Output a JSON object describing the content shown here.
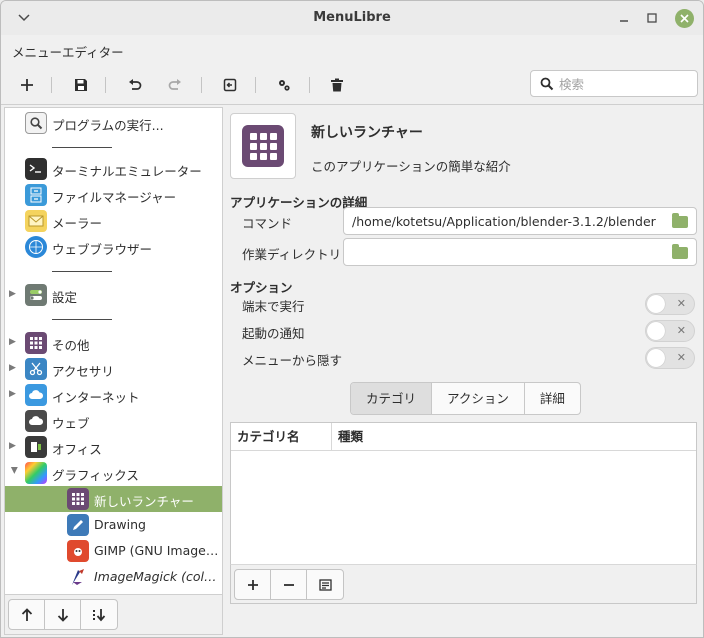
{
  "window": {
    "title": "MenuLibre"
  },
  "menubar": {
    "label": "メニューエディター"
  },
  "search": {
    "placeholder": "検索"
  },
  "tree": {
    "items": [
      {
        "label": "プログラムの実行..."
      },
      {
        "label": "ターミナルエミュレーター"
      },
      {
        "label": "ファイルマネージャー"
      },
      {
        "label": "メーラー"
      },
      {
        "label": "ウェブブラウザー"
      },
      {
        "label": "設定"
      },
      {
        "label": "その他"
      },
      {
        "label": "アクセサリ"
      },
      {
        "label": "インターネット"
      },
      {
        "label": "ウェブ"
      },
      {
        "label": "オフィス"
      },
      {
        "label": "グラフィックス"
      },
      {
        "label": "新しいランチャー"
      },
      {
        "label": "Drawing"
      },
      {
        "label": "GIMP (GNU Image ..."
      },
      {
        "label": "ImageMagick (colo..."
      }
    ]
  },
  "app": {
    "name": "新しいランチャー",
    "comment": "このアプリケーションの簡単な紹介"
  },
  "details": {
    "title": "アプリケーションの詳細",
    "command_label": "コマンド",
    "command_value": "/home/kotetsu/Application/blender-3.1.2/blender",
    "workdir_label": "作業ディレクトリ",
    "workdir_value": ""
  },
  "options": {
    "title": "オプション",
    "run_in_terminal": "端末で実行",
    "startup_notify": "起動の通知",
    "hide_from_menus": "メニューから隠す"
  },
  "tabs": [
    "カテゴリ",
    "アクション",
    "詳細"
  ],
  "categories_table": {
    "col_category": "カテゴリ名",
    "col_type": "種類"
  },
  "colors": {
    "accent": "#8fb16a",
    "launcher_icon": "#6b4a73"
  }
}
